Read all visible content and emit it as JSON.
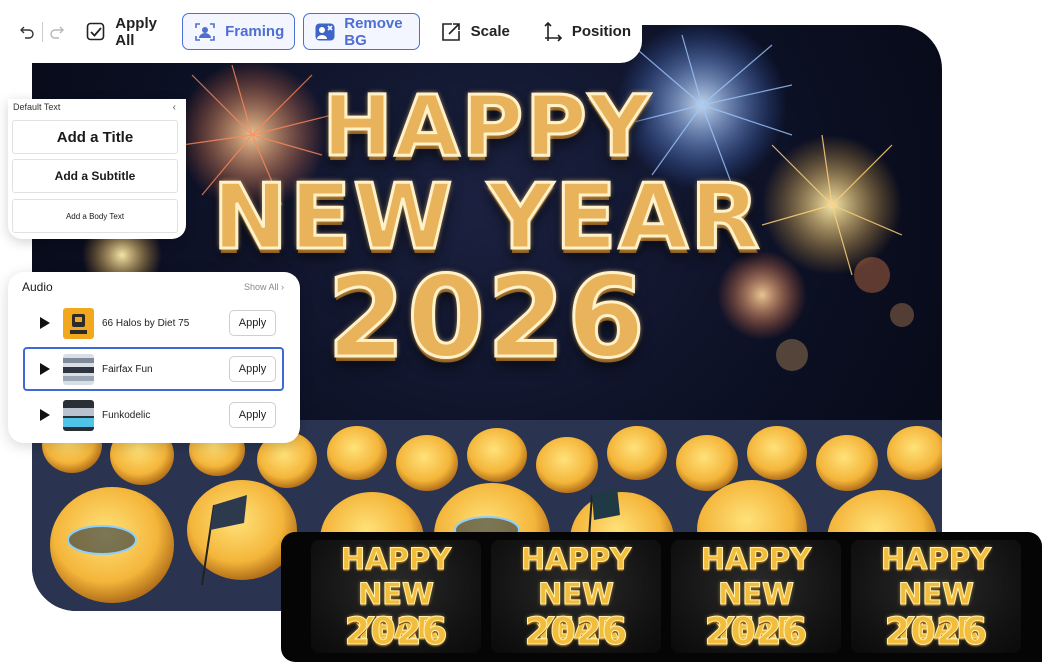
{
  "toolbar": {
    "apply_all": "Apply All",
    "framing": "Framing",
    "remove_bg": "Remove BG",
    "scale": "Scale",
    "position": "Position",
    "icons": [
      "undo-icon",
      "redo-icon",
      "apply-all-icon",
      "framing-icon",
      "remove-bg-icon",
      "scale-icon",
      "position-icon"
    ]
  },
  "canvas": {
    "lines": [
      "HAPPY",
      "NEW YEAR",
      "2026"
    ]
  },
  "text_panel": {
    "title": "Default Text",
    "add_title": "Add a Title",
    "add_subtitle": "Add a Subtitle",
    "add_body": "Add a Body Text"
  },
  "audio": {
    "title": "Audio",
    "show_all": "Show All ›",
    "tracks": [
      {
        "name": "66 Halos by Diet 75",
        "apply": "Apply",
        "selected": false
      },
      {
        "name": "Fairfax Fun",
        "apply": "Apply",
        "selected": true
      },
      {
        "name": "Funkodelic",
        "apply": "Apply",
        "selected": false
      }
    ]
  },
  "filmstrip": {
    "frames": [
      {
        "lines": [
          "HAPPY",
          "NEW YEAR",
          "2026"
        ]
      },
      {
        "lines": [
          "HAPPY",
          "NEW YEAR",
          "2026"
        ]
      },
      {
        "lines": [
          "HAPPY",
          "NEW YEAR",
          "2026"
        ]
      },
      {
        "lines": [
          "HAPPY",
          "NEW YEAR",
          "2026"
        ]
      }
    ]
  },
  "colors": {
    "accent": "#3e6ad4",
    "gold": "#e8b35a",
    "night": "#0b0f22"
  }
}
